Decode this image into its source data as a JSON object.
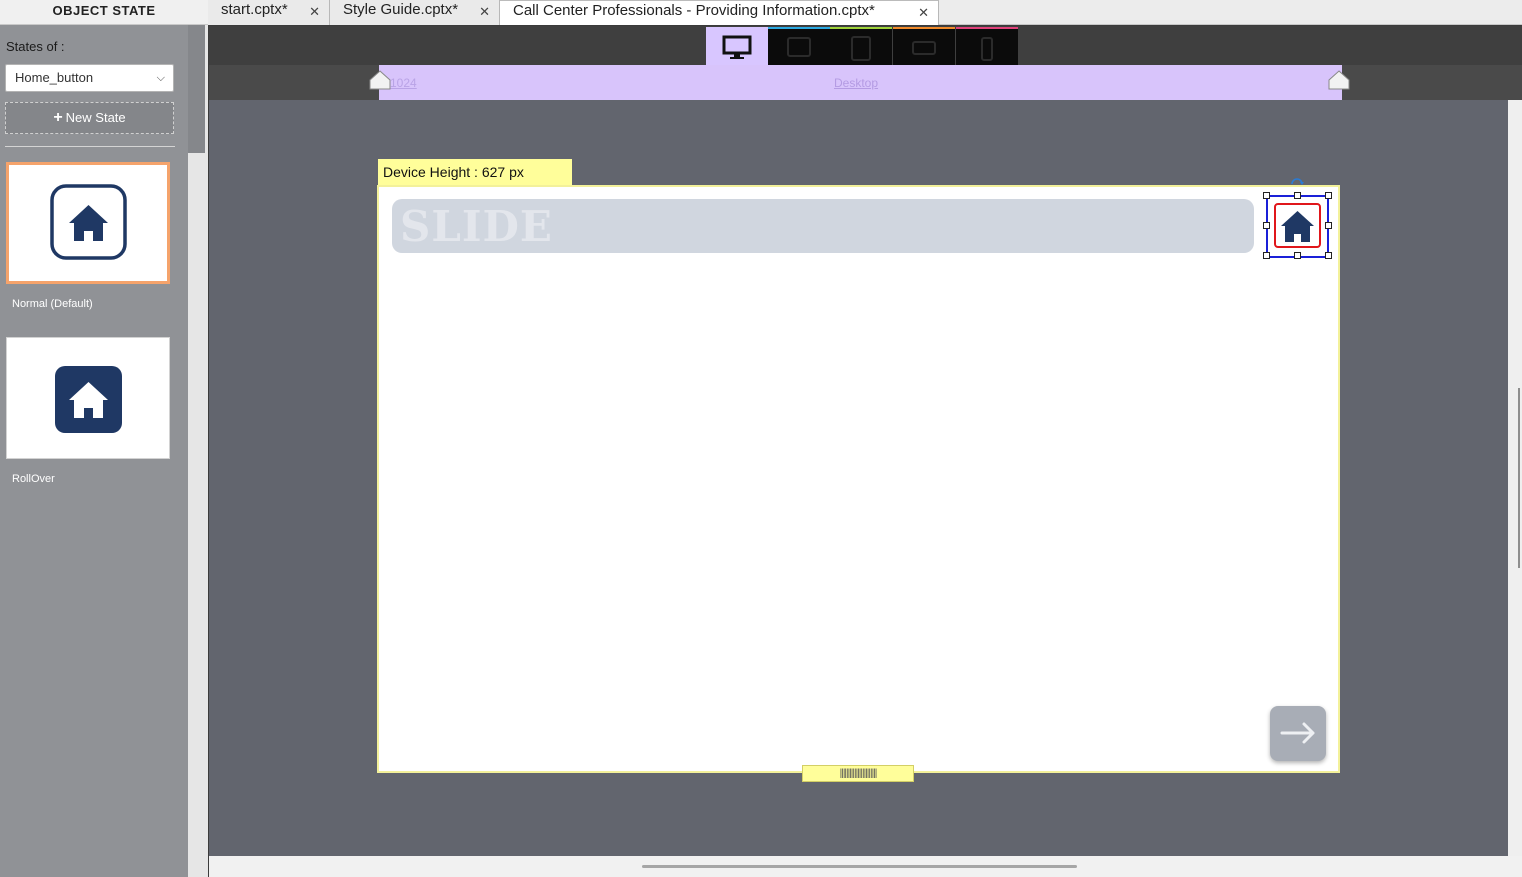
{
  "panel": {
    "title": "OBJECT STATE",
    "states_of_label": "States of :",
    "selected_object": "Home_button",
    "new_state_label": "New State",
    "states": [
      {
        "label": "Normal (Default)"
      },
      {
        "label": "RollOver"
      }
    ]
  },
  "tabs": [
    {
      "label": "start.cptx*"
    },
    {
      "label": "Style Guide.cptx*"
    },
    {
      "label": "Call Center Professionals - Providing Information.cptx*"
    }
  ],
  "ruler": {
    "breakpoint_value": "1024",
    "device_label": "Desktop"
  },
  "stage": {
    "device_height_label": "Device Height : 627 px",
    "slide_title": "SLIDE"
  },
  "devices": {
    "accent_colors": [
      "#2aa8e0",
      "#9fd23a",
      "#f08a2a",
      "#e0417a"
    ],
    "active_color": "#d8c6ff"
  },
  "colors": {
    "brand_navy": "#1f3864",
    "selection_border": "#f5a36b"
  }
}
